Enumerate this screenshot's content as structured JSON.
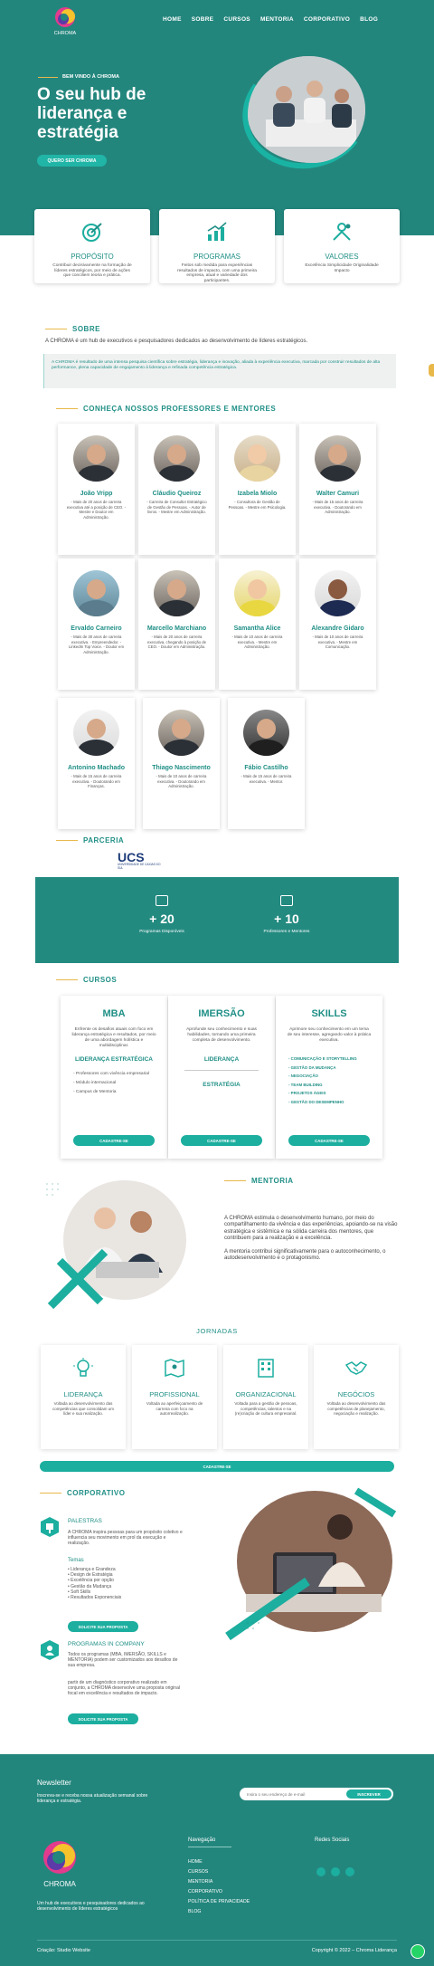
{
  "brand": {
    "name": "CHROMA",
    "accent": "#1f8f86",
    "dark": "#23867d",
    "gold": "#e8b84a"
  },
  "nav": {
    "items": [
      "HOME",
      "SOBRE",
      "CURSOS",
      "MENTORIA",
      "CORPORATIVO",
      "BLOG"
    ]
  },
  "hero": {
    "kicker": "BEM VINDO À CHROMA",
    "title": "O seu hub de liderança e estratégia",
    "cta": "QUERO SER CHROMA"
  },
  "features": [
    {
      "icon": "target-icon",
      "title": "PROPÓSITO",
      "desc": "Contribuir decisivamente na formação de líderes estratégicos, por meio de ações que conciliem teoria e prática."
    },
    {
      "icon": "chart-icon",
      "title": "PROGRAMAS",
      "desc": "Feitos sob medida para experiências resultados de impacto, com uma primeira empresa, atual e variedade dos participantes."
    },
    {
      "icon": "values-icon",
      "title": "VALORES",
      "desc": "Excelência Simplicidade Originalidade Impacto"
    }
  ],
  "about": {
    "heading": "SOBRE",
    "lead": "A CHROMA é um hub de executivos e pesquisadores dedicados ao desenvolvimento de líderes estratégicos.",
    "quote": "A CHROMA é resultado de uma intensa pesquisa científica sobre estratégia, liderança e inovação, aliada à experiência executiva, marcada por construir resultados de alta performance, plena capacidade de engajamento à liderança e refinada competência estratégica."
  },
  "professors": {
    "heading": "CONHEÇA NOSSOS PROFESSORES E MENTORES",
    "items": [
      {
        "name": "João Vripp",
        "bio": "- Mais de 20 anos de carreira executiva até a posição de CEO. - Mestre e Doutor em Administração."
      },
      {
        "name": "Cláudio Queiroz",
        "bio": "- Carreira de Consultor Estratégico de Gestão de Pessoas. - Autor de livros. - Mestre em Administração."
      },
      {
        "name": "Izabela Miolo",
        "bio": "- Consultora de Gestão de Pessoas. - Mestre em Psicologia."
      },
      {
        "name": "Walter Camuri",
        "bio": "- Mais de 15 anos de carreira executiva. - Doutorando em Administração."
      },
      {
        "name": "Ervaldo Carneiro",
        "bio": "- Mais de 30 anos de carreira executiva. - Empreendedor. - LinkedIn Top Voice. - Doutor em Administração."
      },
      {
        "name": "Marcello Marchiano",
        "bio": "- Mais de 20 anos de carreira executiva, chegando à posição de CEO. - Doutor em Administração."
      },
      {
        "name": "Samantha Alice",
        "bio": "- Mais de 10 anos de carreira executiva. - Mestre em Administração."
      },
      {
        "name": "Alexandre Gidaro",
        "bio": "- Mais de 10 anos de carreira executiva. - Mestre em Comunicação."
      },
      {
        "name": "Antonino Machado",
        "bio": "- Mais de 15 anos de carreira executiva. - Doutorando em Finanças."
      },
      {
        "name": "Thiago Nascimento",
        "bio": "- Mais de 10 anos de carreira executiva. - Doutorando em Administração."
      },
      {
        "name": "Fábio Castilho",
        "bio": "- Mais de 15 anos de carreira executiva. - Mentor."
      }
    ]
  },
  "partner": {
    "heading": "PARCERIA",
    "logo": "UCS",
    "logo_sub": "UNIVERSIDADE DE CAXIAS DO SUL"
  },
  "stats": [
    {
      "value": "+ 20",
      "label": "Programas Disponíveis"
    },
    {
      "value": "+ 10",
      "label": "Professores e Mentores"
    }
  ],
  "courses": {
    "heading": "CURSOS",
    "items": [
      {
        "title": "MBA",
        "desc": "Enfrente os desafios atuais com foco em liderança estratégica e resultados, por meio de uma abordagem holística e multidisciplinar.",
        "highlight": "LIDERANÇA ESTRATÉGICA",
        "list": [
          "- Professores com vivência empresarial",
          "- Módulo internacional",
          "- Campus de Mentoria"
        ],
        "cta": "CADASTRE-SE"
      },
      {
        "title": "IMERSÃO",
        "desc": "Aprofunde seu conhecimento e suas habilidades, tornando uma primeira completa de desenvolvimento.",
        "highlight": "LIDERANÇA",
        "highlight2": "ESTRATÉGIA",
        "cta": "CADASTRE-SE"
      },
      {
        "title": "SKILLS",
        "desc": "Aprimore seu conhecimento em um tema de seu interesse, agregando valor à prática executiva.",
        "list": [
          "- COMUNICAÇÃO E STORYTELLING",
          "- GESTÃO DA MUDANÇA",
          "- NEGOCIAÇÃO",
          "- TEAM BUILDING",
          "- PROJETOS ÁGEIS",
          "- GESTÃO DO DESEMPENHO"
        ],
        "cta": "CADASTRE-SE"
      }
    ]
  },
  "mentoria": {
    "heading": "MENTORIA",
    "p1": "A CHROMA estimula o desenvolvimento humano, por meio do compartilhamento da vivência e das experiências, apoiando-se na visão estratégica e sistêmica e na sólida carreira dos mentores, que contribuem para a realização e a excelência.",
    "p2": "A mentoria contribui significativamente para o autoconhecimento, o autodesenvolvimento e o protagonismo."
  },
  "jornadas": {
    "heading": "JORNADAS",
    "items": [
      {
        "icon": "bulb-icon",
        "title": "LIDERANÇA",
        "desc": "Voltada ao desenvolvimento das competências que consolidam um líder e sua realização."
      },
      {
        "icon": "map-icon",
        "title": "PROFISSIONAL",
        "desc": "Voltada ao aperfeiçoamento de carreira com foco na autorrealização."
      },
      {
        "icon": "building-icon",
        "title": "ORGANIZACIONAL",
        "desc": "Voltada para a gestão de pessoas, competências, talentos e na (re)criação de cultura empresarial."
      },
      {
        "icon": "handshake-icon",
        "title": "NEGÓCIOS",
        "desc": "Voltada ao desenvolvimento das competências de planejamento, negociação e realização."
      }
    ],
    "cta": "CADASTRE-SE"
  },
  "corporativo": {
    "heading": "CORPORATIVO",
    "palestras": {
      "title": "PALESTRAS",
      "desc": "A CHROMA inspira pessoas para um propósito coletivo e influencia seu movimento em prol da execução e realização.",
      "temas_label": "Temas",
      "temas": [
        "• Liderança e Grandeza",
        "• Design de Estratégia",
        "• Excelência por opção",
        "• Gestão da Mudança",
        "• Soft Skills",
        "• Resultados Exponenciais"
      ],
      "cta": "SOLICITE SUA PROPOSTA"
    },
    "programas": {
      "title": "PROGRAMAS IN COMPANY",
      "desc": "Todos os programas (MBA, IMERSÃO, SKILLS e MENTORIA) podem ser customizados aos desafios de sua empresa.",
      "desc2": "partir de um diagnóstico corporativo realizado em conjunto, a CHROMA desenvolve uma proposta original focal em excelência e resultados de impacto.",
      "cta": "SOLICITE SUA PROPOSTA"
    }
  },
  "footer": {
    "newsletter_title": "Newsletter",
    "newsletter_desc": "Inscreva-se e receba nossa atualização semanal sobre liderança e estratégia.",
    "email_placeholder": "Insira o seu endereço de e-mail",
    "subscribe": "INSCREVER",
    "tagline": "Um hub de executivos e pesquisadores dedicados ao desenvolvimento de líderes estratégicos",
    "nav_title": "Navegação",
    "links": [
      "HOME",
      "CURSOS",
      "MENTORIA",
      "CORPORATIVO",
      "POLÍTICA DE PRIVACIDADE",
      "BLOG"
    ],
    "social_title": "Redes Sociais",
    "credit": "Criação: Studio Website",
    "copyright": "Copyright © 2022 – Chroma Liderança"
  }
}
